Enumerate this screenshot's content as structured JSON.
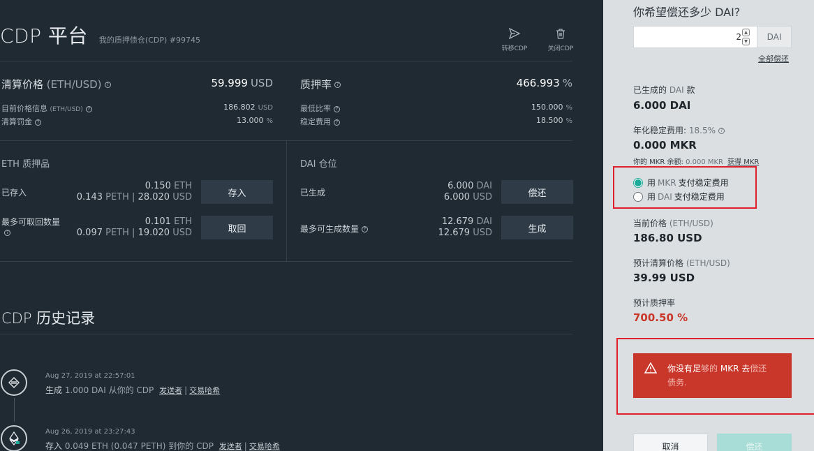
{
  "header": {
    "title": "CDP 平台",
    "subtitle": "我的质押债仓(CDP) #99745",
    "actions": [
      {
        "label": "转移CDP",
        "icon": "send-icon"
      },
      {
        "label": "关闭CDP",
        "icon": "trash-icon"
      }
    ]
  },
  "liquidation": {
    "label": "清算价格",
    "label_unit": "(ETH/USD)",
    "value": "59.999",
    "unit": "USD",
    "price_info_label": "目前价格信息",
    "price_info_unit": "(ETH/USD)",
    "price_info_value": "186.802",
    "price_info_value_unit": "USD",
    "penalty_label": "清算罚金",
    "penalty_value": "13.000",
    "penalty_unit": "%"
  },
  "collateral_ratio": {
    "label": "质押率",
    "value": "466.993",
    "unit": "%",
    "min_ratio_label": "最低比率",
    "min_ratio_value": "150.000",
    "min_ratio_unit": "%",
    "stability_fee_label": "稳定费用",
    "stability_fee_value": "18.500",
    "stability_fee_unit": "%"
  },
  "eth_collateral": {
    "section_label": "ETH 质押品",
    "deposited_label": "已存入",
    "deposited_eth": "0.150",
    "deposited_eth_unit": "ETH",
    "deposited_peth": "0.143",
    "deposited_peth_unit": "PETH",
    "deposited_sep": "|",
    "deposited_usd": "28.020",
    "deposited_usd_unit": "USD",
    "deposit_button": "存入",
    "max_withdraw_label": "最多可取回数量",
    "max_withdraw_eth": "0.101",
    "max_withdraw_eth_unit": "ETH",
    "max_withdraw_peth": "0.097",
    "max_withdraw_peth_unit": "PETH",
    "max_withdraw_sep": "|",
    "max_withdraw_usd": "19.020",
    "max_withdraw_usd_unit": "USD",
    "withdraw_button": "取回"
  },
  "dai_position": {
    "section_label": "DAI 仓位",
    "generated_label": "已生成",
    "generated_dai": "6.000",
    "generated_dai_unit": "DAI",
    "generated_usd": "6.000",
    "generated_usd_unit": "USD",
    "repay_button": "偿还",
    "max_generate_label": "最多可生成数量",
    "max_generate_dai": "12.679",
    "max_generate_dai_unit": "DAI",
    "max_generate_usd": "12.679",
    "max_generate_usd_unit": "USD",
    "generate_button": "生成"
  },
  "history": {
    "title": "CDP 历史记录",
    "entries": [
      {
        "date": "Aug 27, 2019 at 22:57:01",
        "verb": "生成",
        "detail": "1.000 DAI 从你的 CDP",
        "sender_link": "发送者",
        "sep": "|",
        "tx_link": "交易哈希",
        "icon": "dai-icon"
      },
      {
        "date": "Aug 26, 2019 at 23:27:43",
        "verb": "存入",
        "detail": "0.049 ETH (0.047 PETH) 到你的 CDP",
        "sender_link": "发送者",
        "sep": "|",
        "tx_link": "交易哈希",
        "icon": "eth-icon"
      }
    ]
  },
  "panel": {
    "title": "你希望偿还多少 DAI?",
    "amount_value": "2",
    "amount_unit": "DAI",
    "repay_all_link": "全部偿还",
    "generated_label_a": "已生成的",
    "generated_label_b": "DAI",
    "generated_label_c": "款",
    "generated_value": "6.000 DAI",
    "annual_fee_label": "年化稳定费用:",
    "annual_fee_rate": "18.5%",
    "annual_fee_value": "0.000 MKR",
    "mkr_balance_label": "你的 MKR 余额:",
    "mkr_balance_value": "0.000 MKR",
    "get_mkr_link": "获得 MKR",
    "pay_mkr_a": "用",
    "pay_mkr_b": "MKR",
    "pay_mkr_c": "支付稳定费用",
    "pay_dai_a": "用",
    "pay_dai_b": "DAI",
    "pay_dai_c": "支付稳定费用",
    "current_price_label": "当前价格",
    "current_price_unit": "(ETH/USD)",
    "current_price_value": "186.80 USD",
    "proj_liq_label": "预计清算价格",
    "proj_liq_unit": "(ETH/USD)",
    "proj_liq_value": "39.99 USD",
    "proj_ratio_label": "预计质押率",
    "proj_ratio_value": "700.50 %",
    "warning_a": "你没有足",
    "warning_b": "够的",
    "warning_c": "MKR 去",
    "warning_d": "偿还",
    "warning_e": "债务.",
    "cancel_button": "取消",
    "repay_button": "偿还"
  },
  "colors": {
    "background": "#1f2a33",
    "panel": "#dcdfe1",
    "accent": "#1aab9b",
    "danger": "#c9372b",
    "highlight_frame": "#e0212b",
    "ratio_value": "#c9372b"
  }
}
